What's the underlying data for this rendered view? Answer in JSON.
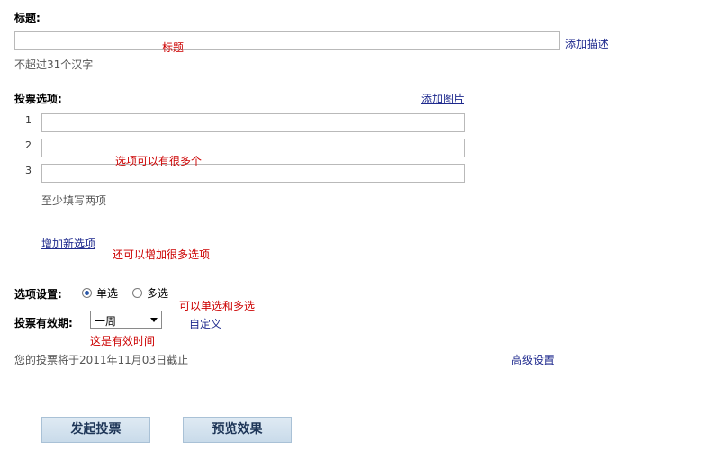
{
  "title_section": {
    "label": "标题:",
    "add_desc_link": "添加描述",
    "hint": "不超过31个汉字",
    "annotation": "标题"
  },
  "options_section": {
    "label": "投票选项:",
    "add_image_link": "添加图片",
    "numbers": [
      "1",
      "2",
      "3"
    ],
    "annotation": "选项可以有很多个",
    "min_hint": "至少填写两项",
    "add_option_link": "增加新选项",
    "add_option_annotation": "还可以增加很多选项"
  },
  "settings": {
    "label": "选项设置:",
    "single": "单选",
    "multi": "多选",
    "selected": "single",
    "annotation": "可以单选和多选"
  },
  "validity": {
    "label": "投票有效期:",
    "selected_value": "一周",
    "custom_link": "自定义",
    "annotation": "这是有效时间"
  },
  "deadline_text": "您的投票将于2011年11月03日截止",
  "advanced_link": "高级设置",
  "buttons": {
    "submit": "发起投票",
    "preview": "预览效果"
  }
}
